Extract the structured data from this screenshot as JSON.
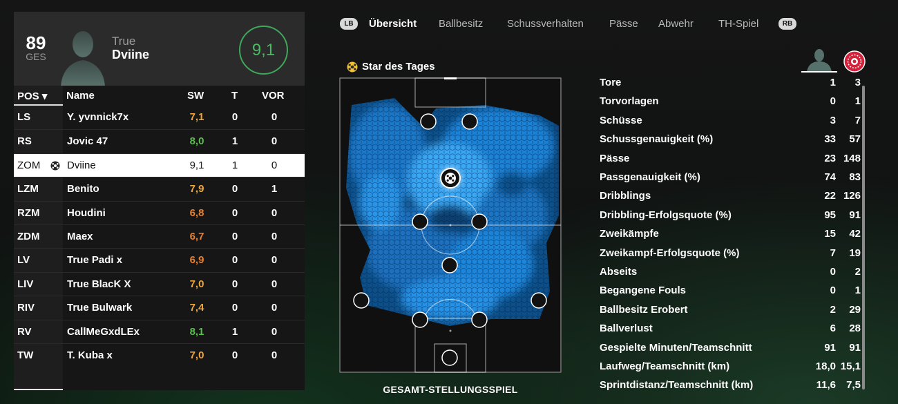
{
  "player_card": {
    "overall": "89",
    "overall_label": "GES",
    "first_name": "True",
    "last_name": "Dviine",
    "match_rating": "9,1"
  },
  "table": {
    "headers": {
      "pos": "POS ▾",
      "name": "Name",
      "sw": "SW",
      "t": "T",
      "vor": "VOR"
    },
    "rows": [
      {
        "pos": "LS",
        "name": "Y. yvnnick7x",
        "sw": "7,1",
        "t": "0",
        "vor": "0",
        "sw_color": "#f2a63a"
      },
      {
        "pos": "RS",
        "name": "Jovic 47",
        "sw": "8,0",
        "t": "1",
        "vor": "0",
        "sw_color": "#5bbf4e"
      },
      {
        "pos": "ZOM",
        "name": "Dviine",
        "sw": "9,1",
        "t": "1",
        "vor": "0",
        "sw_color": "#222222",
        "selected": true,
        "star": "ball-icon"
      },
      {
        "pos": "LZM",
        "name": "Benito",
        "sw": "7,9",
        "t": "0",
        "vor": "1",
        "sw_color": "#f2a63a"
      },
      {
        "pos": "RZM",
        "name": "Houdini",
        "sw": "6,8",
        "t": "0",
        "vor": "0",
        "sw_color": "#e8812f"
      },
      {
        "pos": "ZDM",
        "name": "Maex",
        "sw": "6,7",
        "t": "0",
        "vor": "0",
        "sw_color": "#e8812f"
      },
      {
        "pos": "LV",
        "name": "True Padi x",
        "sw": "6,9",
        "t": "0",
        "vor": "0",
        "sw_color": "#e8812f"
      },
      {
        "pos": "LIV",
        "name": "True BlacK X",
        "sw": "7,0",
        "t": "0",
        "vor": "0",
        "sw_color": "#f2a63a"
      },
      {
        "pos": "RIV",
        "name": "True Bulwark",
        "sw": "7,4",
        "t": "0",
        "vor": "0",
        "sw_color": "#f2a63a"
      },
      {
        "pos": "RV",
        "name": "CallMeGxdLEx",
        "sw": "8,1",
        "t": "1",
        "vor": "0",
        "sw_color": "#5bbf4e"
      },
      {
        "pos": "TW",
        "name": "T. Kuba x",
        "sw": "7,0",
        "t": "0",
        "vor": "0",
        "sw_color": "#f2a63a"
      }
    ]
  },
  "tabs": {
    "left_button": "LB",
    "right_button": "RB",
    "items": [
      "Übersicht",
      "Ballbesitz",
      "Schussverhalten",
      "Pässe",
      "Abwehr",
      "TH-Spiel"
    ],
    "active": "Übersicht"
  },
  "star_of_the_day": "Star des Tages",
  "pitch_caption": "GESAMT-STELLUNGSSPIEL",
  "stats": [
    {
      "label": "Tore",
      "player": "1",
      "team": "3"
    },
    {
      "label": "Torvorlagen",
      "player": "0",
      "team": "1"
    },
    {
      "label": "Schüsse",
      "player": "3",
      "team": "7"
    },
    {
      "label": "Schussgenauigkeit (%)",
      "player": "33",
      "team": "57"
    },
    {
      "label": "Pässe",
      "player": "23",
      "team": "148"
    },
    {
      "label": "Passgenauigkeit (%)",
      "player": "74",
      "team": "83"
    },
    {
      "label": "Dribblings",
      "player": "22",
      "team": "126"
    },
    {
      "label": "Dribbling-Erfolgsquote (%)",
      "player": "95",
      "team": "91"
    },
    {
      "label": "Zweikämpfe",
      "player": "15",
      "team": "42"
    },
    {
      "label": "Zweikampf-Erfolgsquote (%)",
      "player": "7",
      "team": "19"
    },
    {
      "label": "Abseits",
      "player": "0",
      "team": "2"
    },
    {
      "label": "Begangene Fouls",
      "player": "0",
      "team": "1"
    },
    {
      "label": "Ballbesitz Erobert",
      "player": "2",
      "team": "29"
    },
    {
      "label": "Ballverlust",
      "player": "6",
      "team": "28"
    },
    {
      "label": "Gespielte Minuten/Teamschnitt",
      "player": "91",
      "team": "91"
    },
    {
      "label": "Laufweg/Teamschnitt (km)",
      "player": "18,0",
      "team": "15,1"
    },
    {
      "label": "Sprintdistanz/Teamschnitt (km)",
      "player": "11,6",
      "team": "7,5"
    }
  ],
  "colors": {
    "accent_green": "#4fb864",
    "heatmap": "#1e8fe6",
    "selected_row": "#ffffff"
  }
}
